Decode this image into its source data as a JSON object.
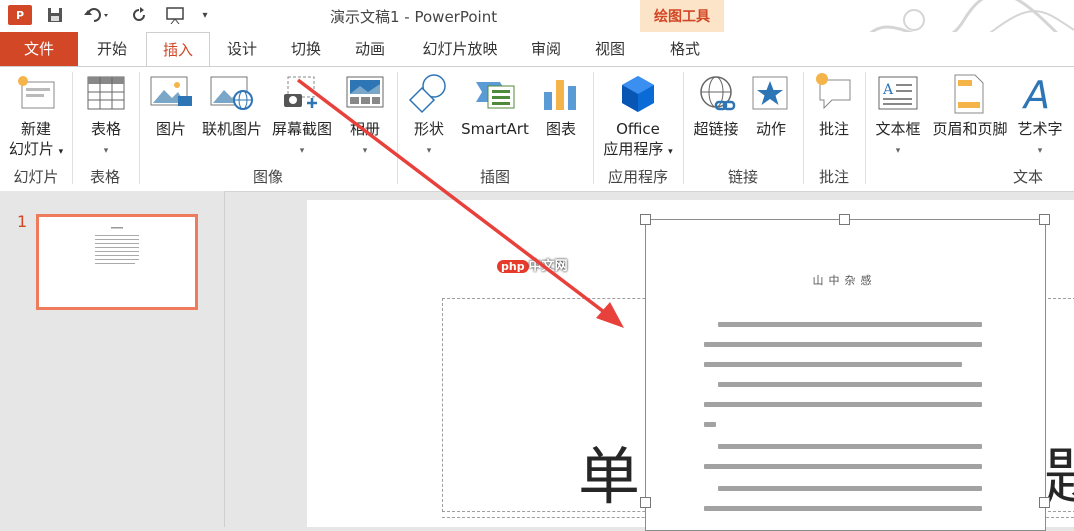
{
  "app": {
    "logo_letter": "P",
    "title": "演示文稿1 - PowerPoint",
    "contextual_group": "绘图工具"
  },
  "tabs": [
    "文件",
    "开始",
    "插入",
    "设计",
    "切换",
    "动画",
    "幻灯片放映",
    "审阅",
    "视图",
    "格式"
  ],
  "ribbon": {
    "buttons": {
      "new_slide": [
        "新建",
        "幻灯片"
      ],
      "table": "表格",
      "picture": "图片",
      "online_picture": "联机图片",
      "screenshot": "屏幕截图",
      "album": "相册",
      "shapes": "形状",
      "smartart": "SmartArt",
      "chart": "图表",
      "office_apps": [
        "Office",
        "应用程序"
      ],
      "hyperlink": "超链接",
      "action": "动作",
      "comment": "批注",
      "textbox": "文本框",
      "header_footer": "页眉和页脚",
      "wordart": "艺术字"
    },
    "groups": {
      "slides": "幻灯片",
      "tables": "表格",
      "images": "图像",
      "illustrations": "插图",
      "apps": "应用程序",
      "links": "链接",
      "comments": "批注",
      "text": "文本"
    }
  },
  "slides_pane": {
    "slide_number": "1"
  },
  "slide": {
    "title_chars_left": "单",
    "title_chars_right": "題",
    "inserted_doc_heading": "山中杂感"
  },
  "watermark": {
    "badge": "php",
    "text": "中文网"
  },
  "colors": {
    "accent": "#d24726",
    "arrow": "#e8413c",
    "thumb_border": "#ef7b5d"
  }
}
